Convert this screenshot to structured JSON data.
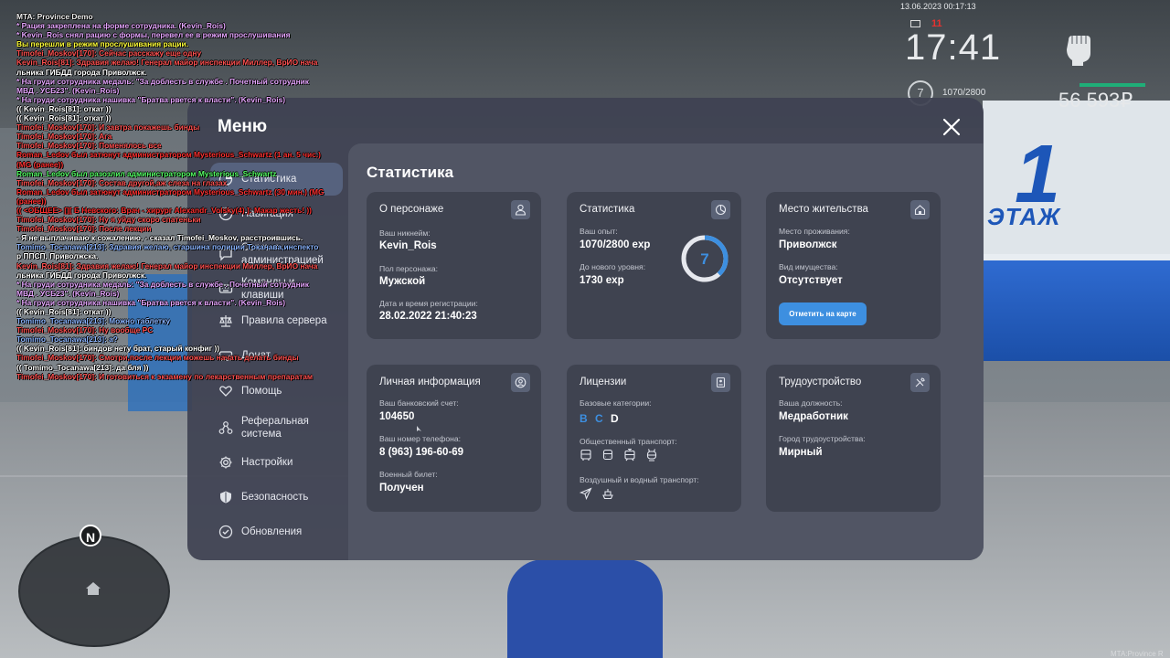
{
  "chat": [
    {
      "text": "MTA: Province Demo",
      "color": "#f0f0f0"
    },
    {
      "text": "* Рация закреплена на форме сотрудника. (Kevin_Rois)",
      "color": "#e6a6ff"
    },
    {
      "text": "* Kevin_Rois снял рацию с формы, перевел ее в режим прослушивания",
      "color": "#e6a6ff"
    },
    {
      "text": "Вы перешли в режим прослушивания рации.",
      "color": "#ffff3a"
    },
    {
      "text": "Timofei_Moskov[170]: Сейчас расскажу еще одну",
      "color": "#ff5050"
    },
    {
      "text": "Kevin_Rois[81]: Здравия желаю! Генерал майор инспекции Миллер, ВрИО нача",
      "color": "#ff5050"
    },
    {
      "text": "льника ГИБДД города Приволжск.",
      "color": "#ffffff"
    },
    {
      "text": "* На груди сотрудника медаль: \"За доблесть в службе . Почетный сотрудник",
      "color": "#e6a6ff"
    },
    {
      "text": " МВД . УСБ23\". (Kevin_Rois)",
      "color": "#e6a6ff"
    },
    {
      "text": "* На груди сотрудника нашивка \"Братва рвется к власти\". (Kevin_Rois)",
      "color": "#e6a6ff"
    },
    {
      "text": "(( Kevin_Rois[81]: откат ))",
      "color": "#ffffff"
    },
    {
      "text": "(( Kevin_Rois[81]: откат ))",
      "color": "#ffffff"
    },
    {
      "text": "Timofei_Moskov[170]: И завтра покажешь бинды",
      "color": "#ff5050"
    },
    {
      "text": "Timofei_Moskov[170]: Ага",
      "color": "#ff5050"
    },
    {
      "text": "Timofei_Moskov[170]: Поменялось все",
      "color": "#ff5050"
    },
    {
      "text": "Roman_Ledov был затюнут администратором Mysterious_Schwartz (1 ан. 5 чис.)",
      "color": "#ff3030"
    },
    {
      "text": "(MG (ранее))",
      "color": "#ff3030"
    },
    {
      "text": "Roman_Ledov был разозлил администратором Mysterious_Schwartz",
      "color": "#55ff66"
    },
    {
      "text": "Timofei_Moskov[170]: Состав другой,аж слеза на глазах",
      "color": "#ff5050"
    },
    {
      "text": "Roman_Ledov был затюнут администратором Mysterious_Schwartz (30 мин.) (MG",
      "color": "#ff3030"
    },
    {
      "text": "(ранее))",
      "color": "#ff3030"
    },
    {
      "text": "(( <ОБЩЕЕ> [][ Б Невского: Врач - хирург Alexandr_Volsky(4) ]: Макар жесть! ))",
      "color": "#ff3030"
    },
    {
      "text": "Timofei_Moskov[170]: Ну я уйду скоро спатеньки",
      "color": "#ff5050"
    },
    {
      "text": "Timofei_Moskov[170]: После лекции",
      "color": "#ff5050"
    },
    {
      "text": "- Я не выплачиваю к сожалению, - сказал Timofei_Moskov, расстроившись.",
      "color": "#ffffff"
    },
    {
      "text": "Tomimo_Tocanawa[213]: Здравия желаю, старшина полиции Токанава,инспекто",
      "color": "#8ab4ff"
    },
    {
      "text": "р ППСП, Приволжска.",
      "color": "#ffffff"
    },
    {
      "text": "Kevin_Rois[81]: Здравия желаю! Генерал майор инспекции Миллер, ВрИО нача",
      "color": "#ff5050"
    },
    {
      "text": "льника ГИБДД города Приволжск.",
      "color": "#ffffff"
    },
    {
      "text": "* На груди сотрудника медаль: \"За доблесть в службе . Почетный сотрудник",
      "color": "#e6a6ff"
    },
    {
      "text": " МВД . УСБ23\". (Kevin_Rois)",
      "color": "#e6a6ff"
    },
    {
      "text": "* На груди сотрудника нашивка \"Братва рвется к власти\". (Kevin_Rois)",
      "color": "#e6a6ff"
    },
    {
      "text": "(( Kevin_Rois[81]: откат ))",
      "color": "#ffffff"
    },
    {
      "text": "Tomimo_Tocanawa[213]: Можно таблетку",
      "color": "#8ab4ff"
    },
    {
      "text": "Timofei_Moskov[170]: Ну вообще PC",
      "color": "#ff5050"
    },
    {
      "text": "Tomimo_Tocanawa[213]: а?",
      "color": "#8ab4ff"
    },
    {
      "text": "(( Kevin_Rois[81]: биндов нету брат, старый конфиг ))",
      "color": "#ffffff"
    },
    {
      "text": "Timofei_Moskov[170]: Смотри,после лекции можешь начать делать бинды",
      "color": "#ff5050"
    },
    {
      "text": "(( Tomimo_Tocanawa[213]: да бля ))",
      "color": "#ffffff"
    },
    {
      "text": "Timofei_Moskov[170]: И готовиться к экзамену по лекарственным препаратам",
      "color": "#ff5050"
    }
  ],
  "hud": {
    "date": "13.06.2023 00:17:13",
    "alert": "11",
    "time": "17:41",
    "level": "7",
    "xp": "1070/2800",
    "money": "56 593₽",
    "footer": "MTA:Province R"
  },
  "minimap": {
    "north": "N"
  },
  "menu": {
    "title": "Меню",
    "nav": [
      {
        "label": "Статистика",
        "icon": "stats-icon"
      },
      {
        "label": "Навигация",
        "icon": "compass-icon"
      },
      {
        "label": "Связь с администрацией",
        "icon": "chat-icon"
      },
      {
        "label": "Команды и клавиши",
        "icon": "keyboard-icon"
      },
      {
        "label": "Правила сервера",
        "icon": "scales-icon"
      },
      {
        "label": "Донат",
        "icon": "wallet-icon"
      },
      {
        "label": "Помощь",
        "icon": "heart-hand-icon"
      },
      {
        "label": "Реферальная система",
        "icon": "referral-icon"
      },
      {
        "label": "Настройки",
        "icon": "gear-icon"
      },
      {
        "label": "Безопасность",
        "icon": "shield-icon"
      },
      {
        "label": "Обновления",
        "icon": "update-icon"
      }
    ]
  },
  "content": {
    "title": "Статистика",
    "character": {
      "title": "О персонаже",
      "nick_label": "Ваш никнейм:",
      "nick": "Kevin_Rois",
      "gender_label": "Пол персонажа:",
      "gender": "Мужской",
      "reg_label": "Дата и время регистрации:",
      "reg": "28.02.2022 21:40:23"
    },
    "stats": {
      "title": "Статистика",
      "exp_label": "Ваш опыт:",
      "exp": "1070/2800 exp",
      "next_label": "До нового уровня:",
      "next": "1730 exp",
      "level": "7",
      "progress": 0.382
    },
    "residence": {
      "title": "Место жительства",
      "place_label": "Место проживания:",
      "place": "Приволжск",
      "property_label": "Вид имущества:",
      "property": "Отсутствует",
      "map_button": "Отметить на карте"
    },
    "personal": {
      "title": "Личная информация",
      "bank_label": "Ваш банковский счет:",
      "bank": "104650",
      "phone_label": "Ваш номер телефона:",
      "phone": "8 (963) 196-60-69",
      "military_label": "Военный билет:",
      "military": "Получен"
    },
    "licenses": {
      "title": "Лицензии",
      "base_label": "Базовые категории:",
      "categories": [
        {
          "letter": "B",
          "color": "#3d8fe0"
        },
        {
          "letter": "C",
          "color": "#3d8fe0"
        },
        {
          "letter": "D",
          "color": "#ffffff"
        }
      ],
      "public_label": "Общественный транспорт:",
      "public_icons": [
        "bus-icon",
        "bus-front-icon",
        "tram-icon",
        "trolleybus-icon"
      ],
      "air_label": "Воздушный и водный транспорт:",
      "air_icons": [
        "plane-icon",
        "boat-icon"
      ]
    },
    "employment": {
      "title": "Трудоустройство",
      "position_label": "Ваша должность:",
      "position": "Медработник",
      "city_label": "Город трудоустройства:",
      "city": "Мирный"
    }
  },
  "colors": {
    "accent": "#3d8fe0",
    "panel": "#3e4252",
    "card": "#3f4350"
  }
}
